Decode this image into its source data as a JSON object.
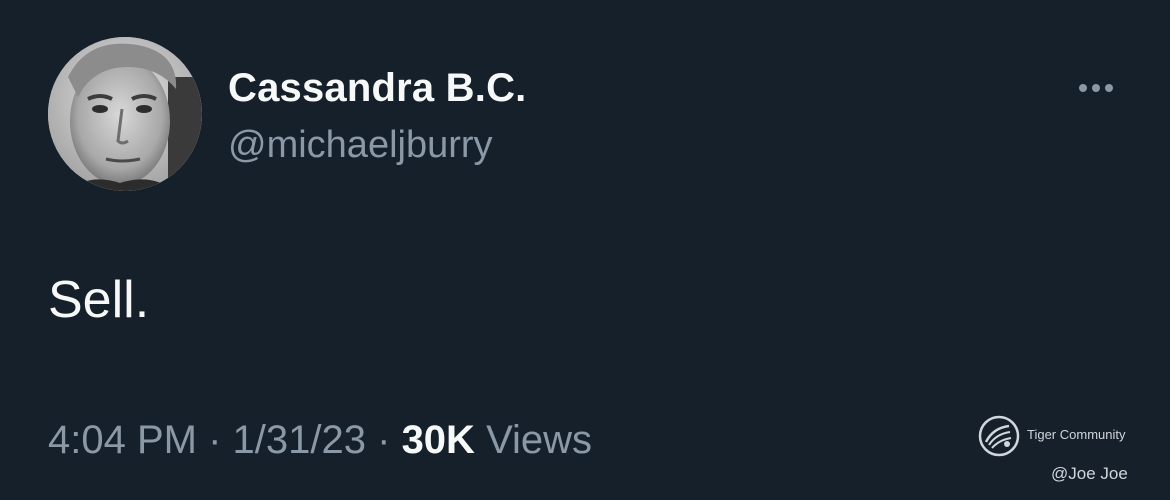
{
  "tweet": {
    "display_name": "Cassandra B.C.",
    "handle": "@michaeljburry",
    "text": "Sell.",
    "time": "4:04 PM",
    "separator": "·",
    "date": "1/31/23",
    "views_count": "30K",
    "views_label": "Views"
  },
  "more_icon": "more-horizontal-icon",
  "watermark": {
    "brand": "Tiger Community",
    "author": "@Joe Joe",
    "logo_icon": "tiger-community-logo-icon"
  },
  "colors": {
    "background": "#15202b",
    "primary_text": "#f7f9f9",
    "secondary_text": "#8b98a5"
  }
}
